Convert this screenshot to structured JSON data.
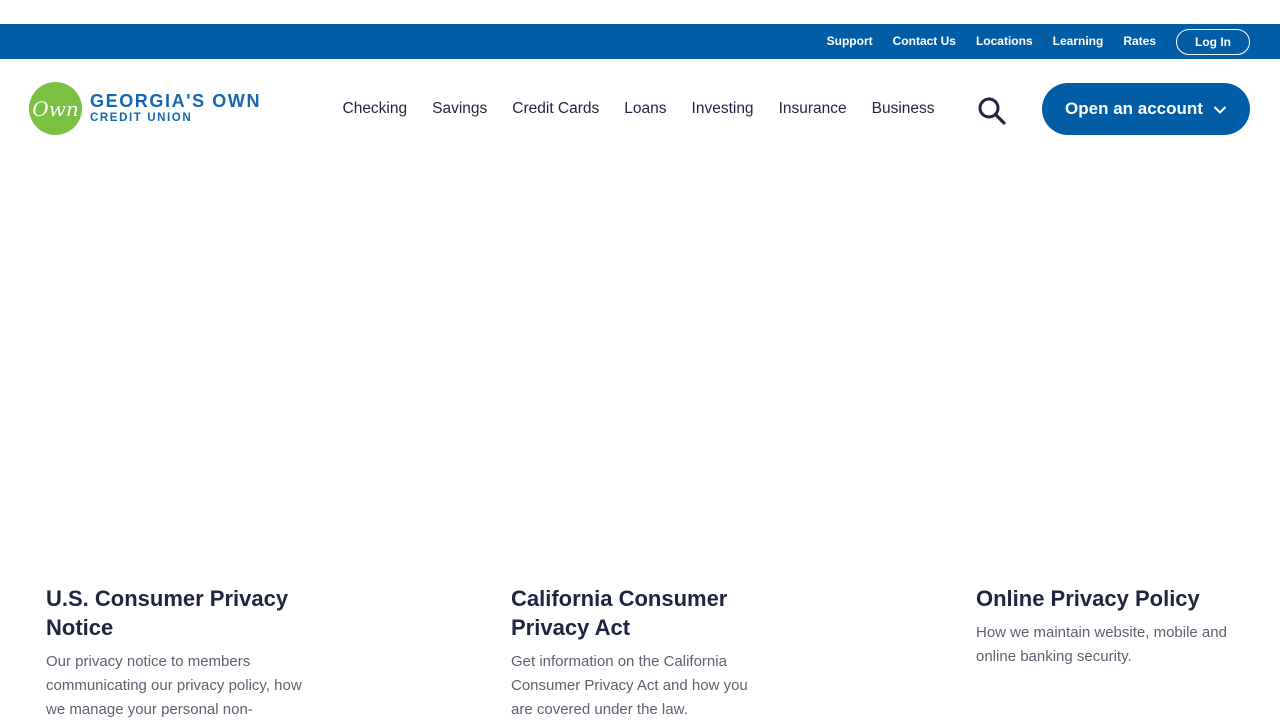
{
  "utility_nav": {
    "links": [
      "Support",
      "Contact Us",
      "Locations",
      "Learning",
      "Rates"
    ],
    "login_label": "Log In"
  },
  "logo": {
    "badge": "Own",
    "line1": "GEORGIA'S OWN",
    "line2": "CREDIT UNION"
  },
  "main_nav": {
    "items": [
      "Checking",
      "Savings",
      "Credit Cards",
      "Loans",
      "Investing",
      "Insurance",
      "Business"
    ],
    "search_icon": "search-icon",
    "cta_label": "Open an account"
  },
  "cards": [
    {
      "title": "U.S. Consumer Privacy Notice",
      "description": "Our privacy notice to members communicating our privacy policy, how we manage your personal non-"
    },
    {
      "title": "California Consumer Privacy Act",
      "description": "Get information on the California Consumer Privacy Act and how you are covered under the law."
    },
    {
      "title": "Online Privacy Policy",
      "description": "How we maintain website, mobile and online banking security."
    }
  ],
  "colors": {
    "brand_blue": "#005da6",
    "brand_green": "#7ac143",
    "text_dark": "#1f2540"
  }
}
